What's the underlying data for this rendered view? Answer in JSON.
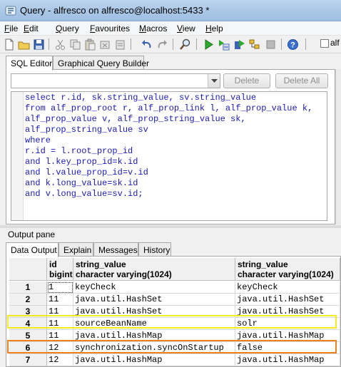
{
  "window": {
    "title": "Query - alfresco on alfresco@localhost:5433 *"
  },
  "menu": [
    {
      "accel": "F",
      "rest": "ile"
    },
    {
      "accel": "E",
      "rest": "dit"
    },
    {
      "accel": "Q",
      "rest": "uery"
    },
    {
      "accel": "F",
      "rest": "avourites"
    },
    {
      "accel": "M",
      "rest": "acros"
    },
    {
      "accel": "V",
      "rest": "iew"
    },
    {
      "accel": "H",
      "rest": "elp"
    }
  ],
  "toolbar": {
    "icons": [
      "new-file-icon",
      "open-folder-icon",
      "save-icon",
      "cut-icon",
      "copy-icon",
      "paste-icon",
      "clear-icon",
      "undo-icon",
      "redo-icon",
      "find-icon",
      "execute-icon",
      "execute-pgscript-icon",
      "execute-to-file-icon",
      "explain-icon",
      "stop-icon",
      "history-icon"
    ],
    "right_checkbox_label": "alf"
  },
  "editor": {
    "tabs": [
      "SQL Editor",
      "Graphical Query Builder"
    ],
    "delete_label": "Delete",
    "delete_all_label": "Delete All",
    "sql_lines": [
      "select r.id, sk.string_value, sv.string_value",
      "from alf_prop_root r, alf_prop_link l, alf_prop_value k,",
      "alf_prop_value v, alf_prop_string_value sk,",
      "alf_prop_string_value sv",
      "where",
      "r.id = l.root_prop_id",
      "and l.key_prop_id=k.id",
      "and l.value_prop_id=v.id",
      "and k.long_value=sk.id",
      "and v.long_value=sv.id;"
    ]
  },
  "output": {
    "pane_label": "Output pane",
    "tabs": [
      "Data Output",
      "Explain",
      "Messages",
      "History"
    ],
    "columns": [
      {
        "name": "id",
        "type": "bigint"
      },
      {
        "name": "string_value",
        "type": "character varying(1024)"
      },
      {
        "name": "string_value",
        "type": "character varying(1024)"
      }
    ],
    "rows": [
      {
        "num": "1",
        "id": "1",
        "key": "keyCheck",
        "value": "keyCheck"
      },
      {
        "num": "2",
        "id": "11",
        "key": "java.util.HashSet",
        "value": "java.util.HashSet"
      },
      {
        "num": "3",
        "id": "11",
        "key": "java.util.HashSet",
        "value": "java.util.HashSet"
      },
      {
        "num": "4",
        "id": "11",
        "key": "sourceBeanName",
        "value": "solr"
      },
      {
        "num": "5",
        "id": "11",
        "key": "java.util.HashMap",
        "value": "java.util.HashMap"
      },
      {
        "num": "6",
        "id": "12",
        "key": "synchronization.syncOnStartup",
        "value": "false"
      },
      {
        "num": "7",
        "id": "12",
        "key": "java.util.HashMap",
        "value": "java.util.HashMap"
      }
    ],
    "highlight_colors": {
      "row_4": "#f5ea1f",
      "row_6": "#f0821e"
    }
  }
}
